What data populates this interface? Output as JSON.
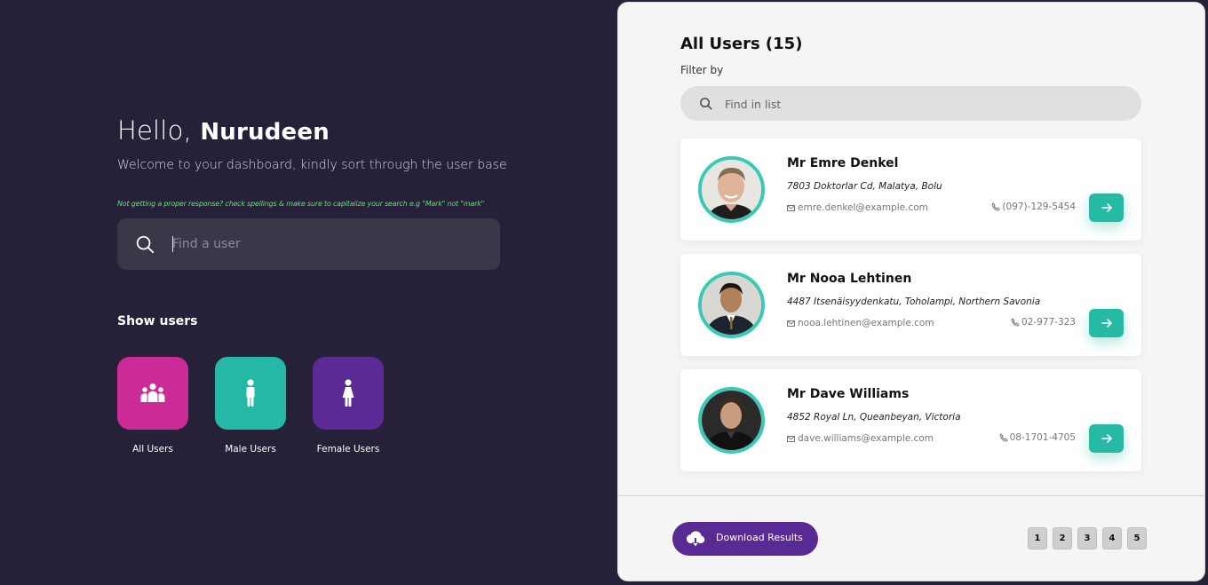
{
  "colors": {
    "background": "#262038",
    "panel": "#f5f5f5",
    "accent_teal": "#26b9a3",
    "all_users_tile": "#cc2a97",
    "male_tile": "#25b8a6",
    "female_tile": "#5b2a94",
    "hint_green": "#5fe07a",
    "download_button": "#5a2a94"
  },
  "greeting": {
    "hello": "Hello, ",
    "name": "Nurudeen",
    "welcome": "Welcome to your dashboard, kindly sort through the user base",
    "hint": "Not getting a proper response? check spellings & make sure to capitalize your search e.g \"Mark\" not \"mark\""
  },
  "main_search": {
    "placeholder": "Find a user",
    "icon": "search-icon"
  },
  "show_users": {
    "heading": "Show users",
    "categories": [
      {
        "label": "All Users",
        "icon": "users-group-icon"
      },
      {
        "label": "Male Users",
        "icon": "male-icon"
      },
      {
        "label": "Female Users",
        "icon": "female-icon"
      }
    ]
  },
  "list": {
    "title": "All Users (15)",
    "filter_label": "Filter by",
    "search_placeholder": "Find in list",
    "users": [
      {
        "name": "Mr Emre Denkel",
        "address": "7803 Doktorlar Cd, Malatya, Bolu",
        "email": "emre.denkel@example.com",
        "phone": "(097)-129-5454"
      },
      {
        "name": "Mr Nooa Lehtinen",
        "address": "4487 Itsenäisyydenkatu, Toholampi, Northern Savonia",
        "email": "nooa.lehtinen@example.com",
        "phone": "02-977-323"
      },
      {
        "name": "Mr Dave Williams",
        "address": "4852 Royal Ln, Queanbeyan, Victoria",
        "email": "dave.williams@example.com",
        "phone": "08-1701-4705"
      }
    ]
  },
  "footer": {
    "download_label": "Download Results",
    "pages": [
      "1",
      "2",
      "3",
      "4",
      "5"
    ]
  }
}
